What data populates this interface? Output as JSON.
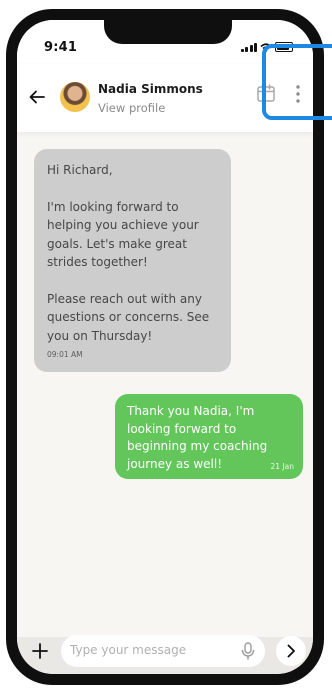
{
  "status_bar": {
    "time": "9:41"
  },
  "header": {
    "contact_name": "Nadia Simmons",
    "subtitle": "View profile"
  },
  "messages": [
    {
      "direction": "incoming",
      "paragraphs": [
        "Hi Richard,",
        "I'm looking forward to helping you achieve your goals. Let's make great strides together!",
        "Please reach out with any questions or concerns. See you on Thursday!"
      ],
      "timestamp": "09:01 AM"
    },
    {
      "direction": "outgoing",
      "text": "Thank you Nadia, I'm looking forward to beginning my coaching journey as well!",
      "timestamp": "21 Jan"
    }
  ],
  "composer": {
    "placeholder": "Type your message"
  },
  "colors": {
    "incoming_bubble": "#cdcdcd",
    "outgoing_bubble": "#63c65a",
    "highlight": "#1e88e5",
    "background": "#f7f6f2"
  },
  "icons": [
    "back-arrow-icon",
    "calendar-icon",
    "more-vertical-icon",
    "plus-icon",
    "microphone-icon",
    "chevron-right-icon",
    "signal-icon",
    "wifi-icon",
    "battery-icon"
  ]
}
